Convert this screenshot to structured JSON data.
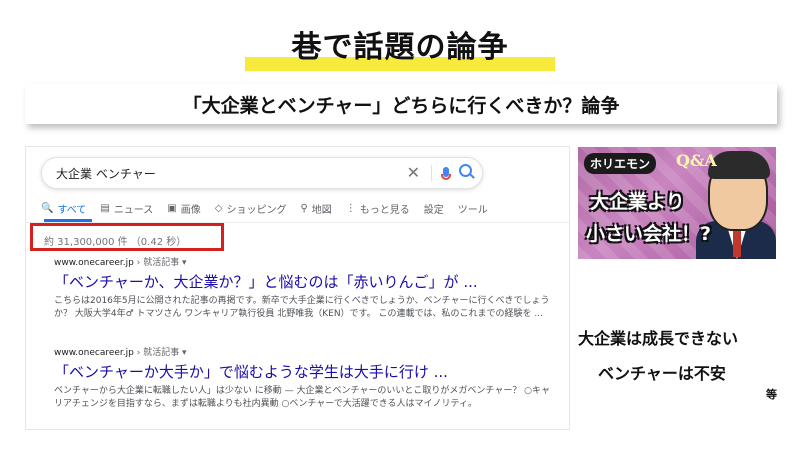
{
  "title": "巷で話題の論争",
  "subtitle": "「大企業とベンチャー」どちらに行くべきか？論争",
  "search": {
    "query": "大企業 ベンチャー",
    "tabs": [
      {
        "icon": "🔍",
        "label": "すべて"
      },
      {
        "icon": "▤",
        "label": "ニュース"
      },
      {
        "icon": "▣",
        "label": "画像"
      },
      {
        "icon": "◇",
        "label": "ショッピング"
      },
      {
        "icon": "⚲",
        "label": "地図"
      },
      {
        "icon": "⋮",
        "label": "もっと見る"
      },
      {
        "icon": "",
        "label": "設定"
      },
      {
        "icon": "",
        "label": "ツール"
      }
    ],
    "stats": "約 31,300,000 件 （0.42 秒）",
    "results": [
      {
        "url": "www.onecareer.jp",
        "crumb": "› 就活記事 ▾",
        "title": "「ベンチャーか、大企業か？」と悩むのは「赤いりんご」が ...",
        "snippet": "こちらは2016年5月に公開された記事の再掲です。新卒で大手企業に行くべきでしょうか、ベンチャーに行くべきでしょうか？ 大阪大学4年♂ トマツさん ワンキャリア執行役員 北野唯我（KEN）です。 この連載では、私のこれまでの経験を ..."
      },
      {
        "url": "www.onecareer.jp",
        "crumb": "› 就活記事 ▾",
        "title": "「ベンチャーか大手か」で悩むような学生は大手に行け ...",
        "snippet": "ベンチャーから大企業に転職したい人」は少ない に移動 — 大企業とベンチャーのいいとこ取りがメガベンチャー？ ○キャリアチェンジを目指すなら、まずは転職よりも社内異動 ○ベンチャーで大活躍できる人はマイノリティ。"
      }
    ]
  },
  "thumbnail": {
    "brand": "ホリエモン",
    "qa": "Q&A",
    "line1": "大企業より",
    "line2": "小さい会社！?"
  },
  "opinions": [
    "大企業は成長できない",
    "ベンチャーは不安"
  ],
  "etc": "等"
}
